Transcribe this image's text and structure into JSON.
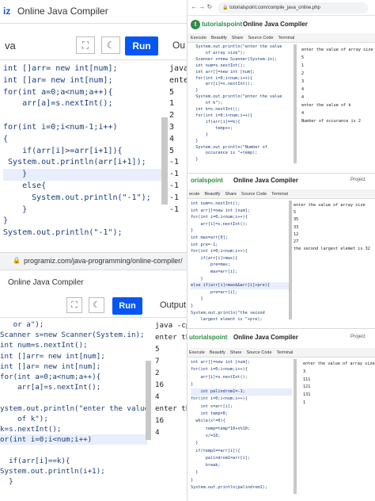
{
  "p1": {
    "logo_mark": "iz",
    "title": "Online Java Compiler",
    "tab": "va",
    "run_label": "Run",
    "output_tab": "Ou",
    "code_lines": [
      "int []arr= new int[num];",
      "int []ar= new int[num];",
      "for(int a=0;a<num;a++){",
      "    arr[a]=s.nextInt();",
      "",
      "for(int i=0;i<num-1;i++)",
      "{",
      "    if(arr[i]>=arr[i+1]){",
      " System.out.println(arr[i+1]);",
      "    }",
      "    else{",
      "      System.out.println(\"-1\");",
      "    }",
      "}",
      "System.out.println(\"-1\");"
    ],
    "output_lines": [
      "java",
      "ente",
      "5",
      "1",
      "2",
      "3",
      "4",
      "5",
      "-1",
      "-1",
      "-1",
      "-1",
      "-1"
    ]
  },
  "p2": {
    "url": "tutorialspoint.com/compile_java_online.php",
    "brand": "tutorialspoint",
    "title": "Online Java Compiler",
    "toolbar": [
      "Execute",
      "Beautify",
      "Share",
      "Source Code",
      "Terminal"
    ],
    "code_lines": [
      "  System.out.println(\"enter the value",
      "      of array size\");",
      "  Scanner s=new Scanner(System.in);",
      "  int num=s.nextInt();",
      "  int arr[]=new int [num];",
      "  for(int i=0;i<num;i++){",
      "      arr[i]=s.nextInt();",
      "  }",
      "  System.out.println(\"enter the value",
      "      of k\");",
      "  int k=s.nextInt();",
      "  for(int i=0;i<num;i++){",
      "      if(arr[i]==k){",
      "          temp++;",
      "      }",
      "  }",
      "  System.out.println(\"Number of",
      "      occurance is \"+temp);",
      "  }"
    ],
    "output_lines": [
      "enter the value of array size",
      "5",
      "1",
      "2",
      "3",
      "4",
      "4",
      "enter the value of k",
      "4",
      "Number of occurance is 2"
    ]
  },
  "p3": {
    "brand": "orialspoint",
    "title": "Online Java Compiler",
    "toolbar": [
      "ecute",
      "Beautify",
      "Share",
      "Source Code",
      "Terminal"
    ],
    "project": "Project",
    "code_lines": [
      "int num=s.nextInt();",
      "int arr[]=new int [num];",
      "for(int i=0;i<num;i++){",
      "    arr[i]=s.nextInt();",
      "}",
      "int max=arr[0];",
      "int pre=-1;",
      "for(int i=0;i<num;i++){",
      "    if(arr[i]>max){",
      "        pre=max;",
      "        max=arr[i];",
      "    }",
      "else if(arr[i]<max&&arr[i]>pre){",
      "        pre=arr[i];",
      "    }",
      "}",
      "System.out.println(\"the second",
      "    largest eleent is \"+pre);"
    ],
    "output_lines": [
      "enter the value of array size",
      "5",
      "35",
      "33",
      "12",
      "27",
      "the second largest elemet is 32"
    ]
  },
  "p4": {
    "url": "programiz.com/java-programming/online-compiler/",
    "title": "Online Java Compiler",
    "run_label": "Run",
    "output_tab": "Output",
    "code_lines": [
      "   or a\");",
      "Scanner s=new Scanner(System.in);",
      "int num=s.nextInt();",
      "int []arr= new int[num];",
      "int []ar= new int[num];",
      "for(int a=0;a<num;a++){",
      "    arr[a]=s.nextInt();",
      "",
      "ystem.out.println(\"enter the value",
      "    of k\");",
      "k=s.nextInt();",
      "or(int i=0;i<num;i++)",
      "",
      "  if(arr[i]==k){",
      "System.out.println(i+1);",
      "  }"
    ],
    "output_lines": [
      "java -cp",
      "enter th",
      "5",
      "7",
      "2",
      "16",
      "4",
      "enter th",
      "16",
      "4"
    ]
  },
  "p5": {
    "brand": "utorialspoint",
    "title": "Online Java Compiler",
    "toolbar": [
      "Execute",
      "Beautify",
      "Share",
      "Source Code",
      "Terminal"
    ],
    "project": "Project",
    "code_lines": [
      "int arr[]=new int [num];",
      "for(int i=0;i<num;i++){",
      "    arr[i]=s.nextInt();",
      "}",
      "    int palindrom1=-1;",
      "for(int i=0;i<num;i++){",
      "    int x=arr[i];",
      "    int temp=0;",
      "  while(x!=0){",
      "      temp=temp*10+x%10;",
      "      x/=10;",
      "  }",
      "  if(temp1==arr[i]){",
      "      palindrom1=arr[i];",
      "      break;",
      "  }",
      "}",
      "System.out.println(palindrom1);"
    ],
    "output_lines": [
      "enter the value of array size",
      "3",
      "111",
      "121",
      "131",
      "1"
    ]
  }
}
